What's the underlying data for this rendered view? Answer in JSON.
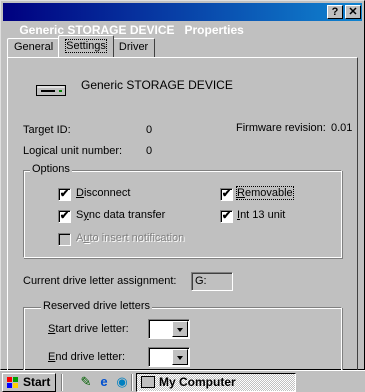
{
  "window": {
    "title": "Generic STORAGE DEVICE   Properties",
    "help_btn": "?",
    "close_btn": "✕"
  },
  "tabs": [
    {
      "label": "General"
    },
    {
      "label": "Settings"
    },
    {
      "label": "Driver"
    }
  ],
  "device": {
    "name": "Generic STORAGE DEVICE",
    "icon": "drive-icon"
  },
  "info": {
    "target_id_label": "Target ID:",
    "target_id_value": "0",
    "firmware_label": "Firmware revision:",
    "firmware_value": "0.01",
    "lun_label": "Logical unit number:",
    "lun_value": "0"
  },
  "options": {
    "legend": "Options",
    "disconnect": {
      "label_u": "D",
      "label_rest": "isconnect",
      "checked": true
    },
    "removable": {
      "label_u": "R",
      "label_rest": "emovable",
      "checked": true
    },
    "sync": {
      "label_pre": "S",
      "label_u": "y",
      "label_rest": "nc data transfer",
      "checked": true
    },
    "int13": {
      "label_u": "I",
      "label_rest": "nt 13 unit",
      "checked": true
    },
    "auto_insert": {
      "label_pre": "A",
      "label_u": "u",
      "label_rest": "to insert notification",
      "checked": false,
      "enabled": false
    }
  },
  "drive_letter": {
    "current_label": "Current drive letter assignment:",
    "current_value": "G:"
  },
  "reserved": {
    "legend": "Reserved drive letters",
    "start_u": "S",
    "start_rest": "tart drive letter:",
    "start_value": "",
    "end_u": "E",
    "end_rest": "nd drive letter:",
    "end_value": ""
  },
  "taskbar": {
    "start_label": "Start",
    "quicklaunch": [
      "desktop-icon",
      "internet-explorer-icon",
      "channels-icon"
    ],
    "task_label": "My Computer"
  },
  "colors": {
    "title_start": "#000080",
    "title_end": "#1084d0",
    "face": "#c0c0c0"
  }
}
